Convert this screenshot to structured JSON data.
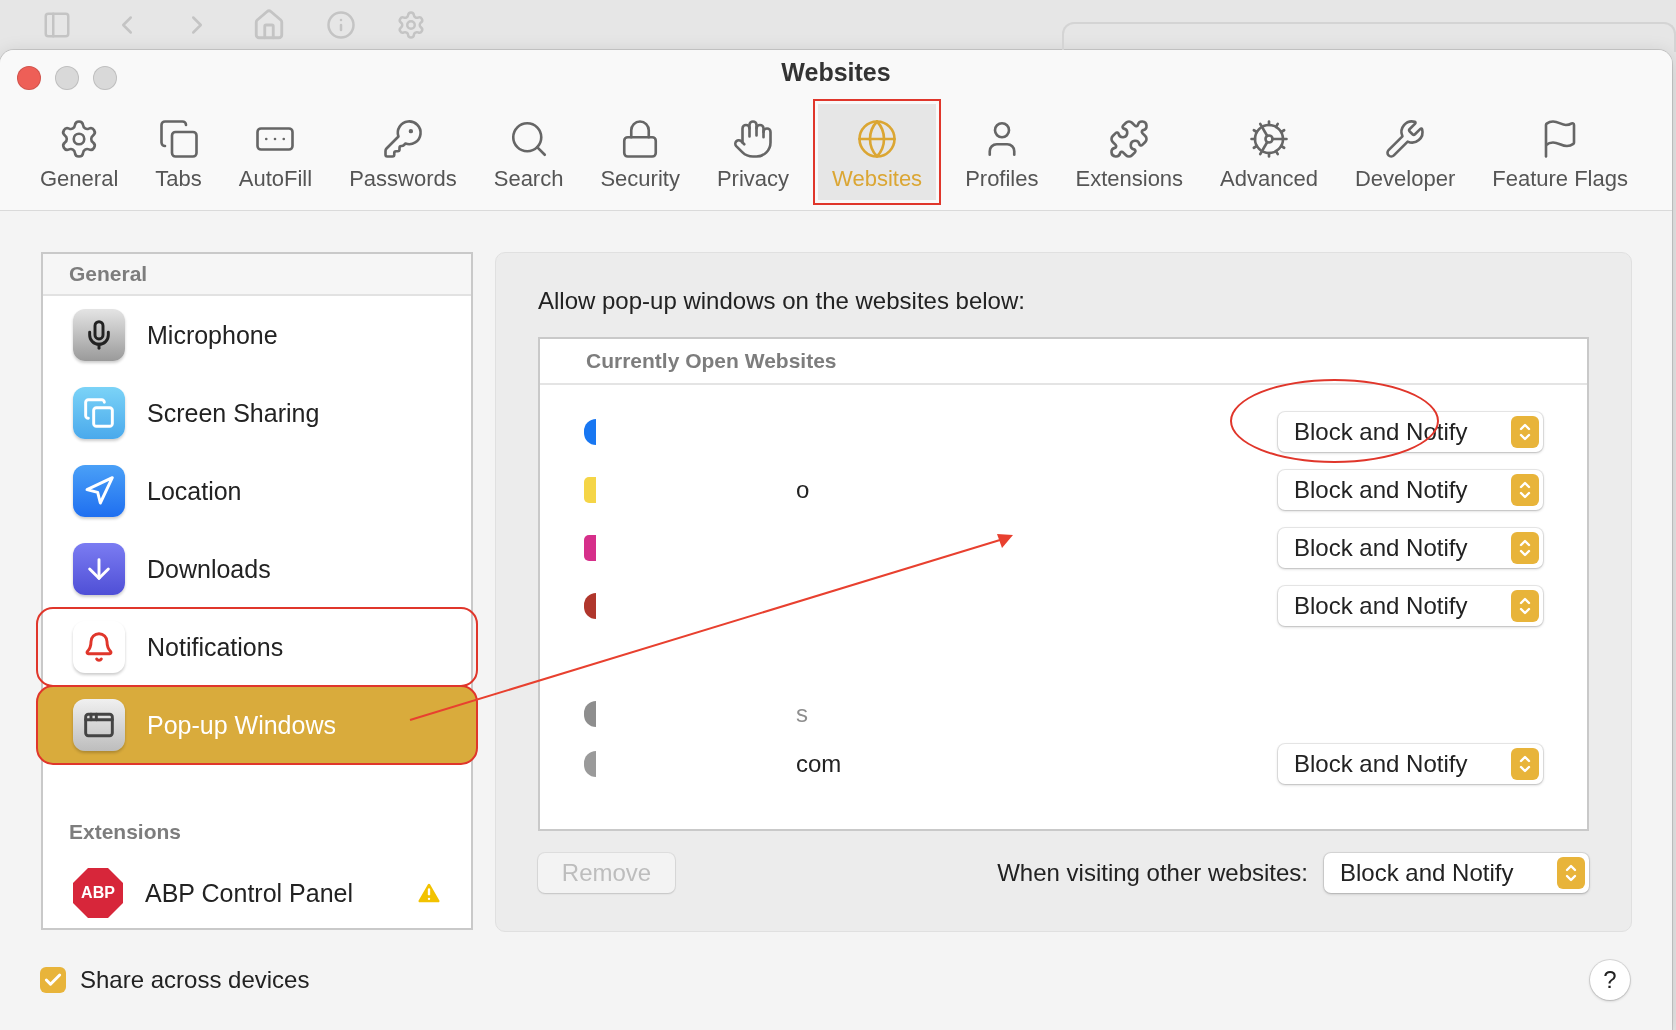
{
  "window": {
    "title": "Websites"
  },
  "toolbar": [
    {
      "label": "General",
      "selected": false,
      "highlighted": false
    },
    {
      "label": "Tabs",
      "selected": false,
      "highlighted": false
    },
    {
      "label": "AutoFill",
      "selected": false,
      "highlighted": false
    },
    {
      "label": "Passwords",
      "selected": false,
      "highlighted": false
    },
    {
      "label": "Search",
      "selected": false,
      "highlighted": false
    },
    {
      "label": "Security",
      "selected": false,
      "highlighted": false
    },
    {
      "label": "Privacy",
      "selected": false,
      "highlighted": false
    },
    {
      "label": "Websites",
      "selected": true,
      "highlighted": true
    },
    {
      "label": "Profiles",
      "selected": false,
      "highlighted": false
    },
    {
      "label": "Extensions",
      "selected": false,
      "highlighted": false
    },
    {
      "label": "Advanced",
      "selected": false,
      "highlighted": false
    },
    {
      "label": "Developer",
      "selected": false,
      "highlighted": false
    },
    {
      "label": "Feature Flags",
      "selected": false,
      "highlighted": false
    }
  ],
  "sidebar": {
    "sections": [
      {
        "title": "General",
        "items": [
          {
            "label": "Microphone",
            "selected": false,
            "highlighted": false
          },
          {
            "label": "Screen Sharing",
            "selected": false,
            "highlighted": false
          },
          {
            "label": "Location",
            "selected": false,
            "highlighted": false
          },
          {
            "label": "Downloads",
            "selected": false,
            "highlighted": false
          },
          {
            "label": "Notifications",
            "selected": false,
            "highlighted": true
          },
          {
            "label": "Pop-up Windows",
            "selected": true,
            "highlighted": true
          }
        ]
      },
      {
        "title": "Extensions",
        "items": [
          {
            "label": "ABP Control Panel",
            "logo_text": "ABP",
            "warning": true,
            "selected": false,
            "highlighted": false
          }
        ]
      }
    ]
  },
  "panel": {
    "heading": "Allow pop-up windows on the websites below:",
    "table": {
      "header": "Currently Open Websites",
      "rows": [
        {
          "kind": "site",
          "color": "#1877f2",
          "fragment": "",
          "setting": "Block and Notify",
          "circled": true
        },
        {
          "kind": "site",
          "color": "#f5d547",
          "fragment": "o",
          "setting": "Block and Notify",
          "circled": false
        },
        {
          "kind": "site",
          "color": "#d62f8a",
          "fragment": "",
          "setting": "Block and Notify",
          "circled": false
        },
        {
          "kind": "site",
          "color": "#b0362c",
          "fragment": "",
          "setting": "Block and Notify",
          "circled": false
        },
        {
          "kind": "muted",
          "color": "#8e8e8e",
          "fragment": "s"
        },
        {
          "kind": "site",
          "color": "#9a9a9a",
          "fragment": "com",
          "setting": "Block and Notify",
          "circled": false
        }
      ]
    },
    "remove_button": {
      "label": "Remove",
      "disabled": true
    },
    "other_label": "When visiting other websites:",
    "other_setting": "Block and Notify"
  },
  "share": {
    "label": "Share across devices",
    "checked": true
  },
  "help": "?",
  "annotations": [
    {
      "kind": "arrow"
    }
  ]
}
